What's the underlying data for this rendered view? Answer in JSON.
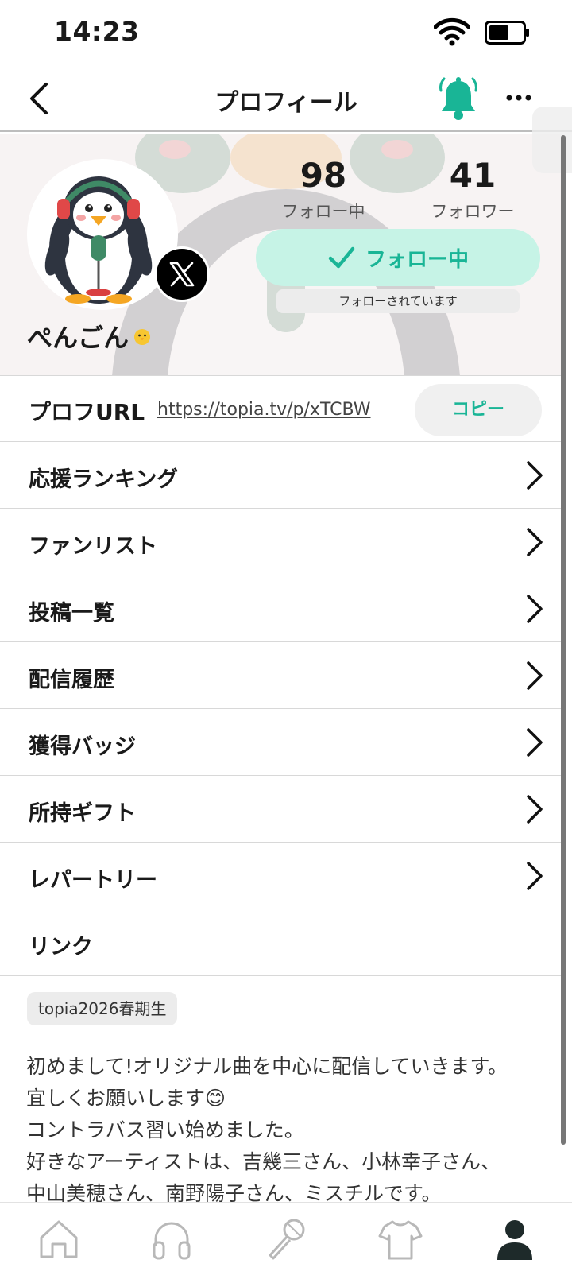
{
  "status_bar": {
    "time": "14:23"
  },
  "nav": {
    "title": "プロフィール",
    "icons": [
      "back-icon",
      "bell-ringing-icon",
      "more-icon"
    ]
  },
  "profile": {
    "username": "ぺんごん",
    "following_count": "98",
    "following_label": "フォロー中",
    "followers_count": "41",
    "followers_label": "フォロワー",
    "follow_button_label": "フォロー中",
    "followed_badge": "フォローされています",
    "social_badge": "x-logo-icon"
  },
  "prof_url": {
    "label": "プロフURL",
    "url": "https://topia.tv/p/xTCBW",
    "copy_label": "コピー"
  },
  "menu": {
    "items": [
      {
        "label": "応援ランキング",
        "has_chevron": true
      },
      {
        "label": "ファンリスト",
        "has_chevron": true
      },
      {
        "label": "投稿一覧",
        "has_chevron": true
      },
      {
        "label": "配信履歴",
        "has_chevron": true
      },
      {
        "label": "獲得バッジ",
        "has_chevron": true
      },
      {
        "label": "所持ギフト",
        "has_chevron": true
      },
      {
        "label": "レパートリー",
        "has_chevron": true
      },
      {
        "label": "リンク",
        "has_chevron": false
      }
    ]
  },
  "tag": "topia2026春期生",
  "bio": {
    "lines": [
      "初めまして!オリジナル曲を中心に配信していきます。",
      "宜しくお願いします😊",
      "コントラバス習い始めました。",
      "好きなアーティストは、吉幾三さん、小林幸子さん、",
      "中山美穂さん、南野陽子さん、ミスチルです。"
    ]
  },
  "tab_bar": {
    "tabs": [
      {
        "name": "home-icon",
        "active": false
      },
      {
        "name": "headphones-icon",
        "active": false
      },
      {
        "name": "microphone-icon",
        "active": false
      },
      {
        "name": "tshirt-icon",
        "active": false
      },
      {
        "name": "person-icon",
        "active": true
      }
    ]
  },
  "colors": {
    "accent": "#19b596",
    "accent_light": "#c6f3e6",
    "active_tab": "#1e2a2a",
    "inactive_tab": "#b8b8b8"
  }
}
